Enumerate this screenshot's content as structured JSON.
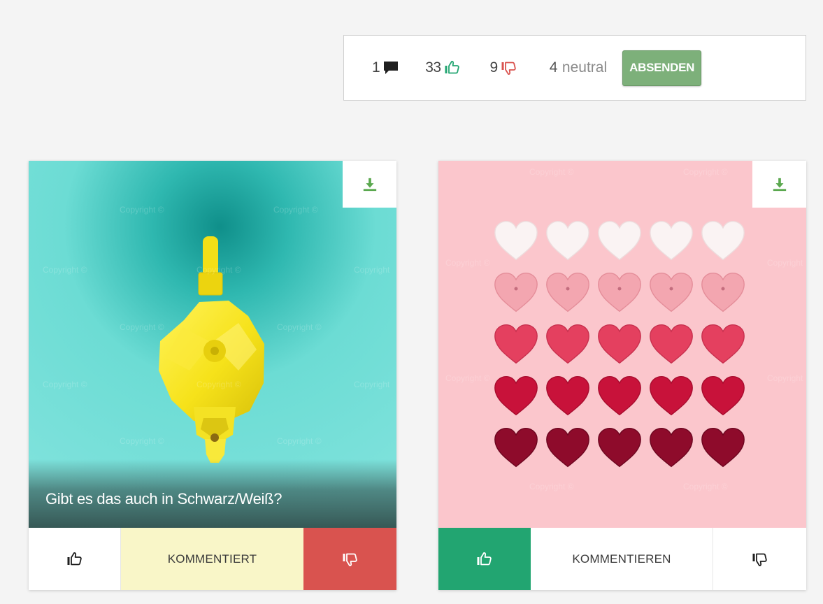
{
  "summary": {
    "comments_count": "1",
    "likes_count": "33",
    "dislikes_count": "9",
    "neutral_count": "4",
    "neutral_label": "neutral",
    "submit_label": "ABSENDEN"
  },
  "colors": {
    "like_green": "#22a571",
    "dislike_red": "#d9534f",
    "submit_green": "#7db07a",
    "commented_yellow": "#f9f6c8"
  },
  "cards": [
    {
      "image": "yellow-moka-pot-on-turquoise",
      "download_icon": "download-icon",
      "caption": "Gibt es das auch in Schwarz/Weiß?",
      "comment_label": "KOMMENTIERT",
      "vote": "dislike"
    },
    {
      "image": "crochet-hearts-on-pink",
      "download_icon": "download-icon",
      "caption": "",
      "comment_label": "KOMMENTIEREN",
      "vote": "like"
    }
  ]
}
